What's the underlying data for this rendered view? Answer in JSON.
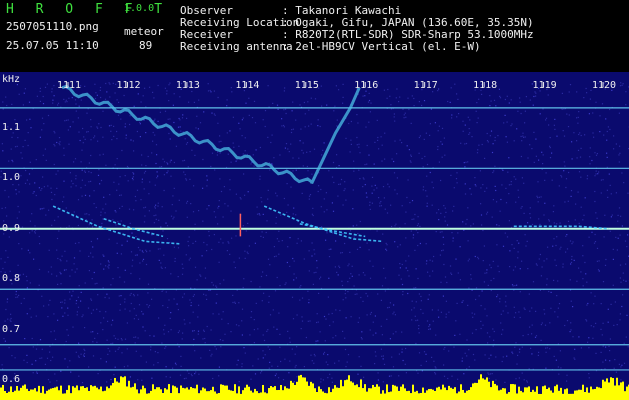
{
  "header": {
    "app_title": "H R O F F T",
    "version": "1.0.0",
    "filename": "2507051110.png",
    "kind": "meteor",
    "datetime": "25.07.05 11:10",
    "count": "89",
    "fields": [
      {
        "label": "Observer",
        "value": ": Takanori Kawachi"
      },
      {
        "label": "Receiving Location",
        "value": ": Ogaki, Gifu, JAPAN (136.60E, 35.35N)"
      },
      {
        "label": "Receiver",
        "value": ": R820T2(RTL-SDR) SDR-Sharp 53.1000MHz"
      },
      {
        "label": "Receiving antenna",
        "value": ": 2el-HB9CV Vertical (el. E-W)"
      }
    ]
  },
  "chart_data": {
    "type": "heatmap",
    "ylabel": "kHz",
    "ylim": [
      0.58,
      1.18
    ],
    "yticks": [
      "1.1",
      "1.0",
      "0.9",
      "0.8",
      "0.7",
      "0.6"
    ],
    "ytick_values": [
      1.1,
      1.0,
      0.9,
      0.8,
      0.7,
      0.6
    ],
    "xlim": [
      1110.5,
      1120.2
    ],
    "xticks": [
      "1111",
      "1112",
      "1113",
      "1114",
      "1115",
      "1116",
      "1117",
      "1118",
      "1119",
      "1120"
    ],
    "xtick_values": [
      1111,
      1112,
      1113,
      1114,
      1115,
      1116,
      1117,
      1118,
      1119,
      1120
    ],
    "carrier_lines_khz": [
      1.14,
      1.02,
      0.9,
      0.78,
      0.67,
      0.62
    ],
    "main_carrier_khz": 0.9,
    "colors": {
      "background": "#0a0a6e",
      "carrier": "#70e0ff",
      "main_carrier": "#c0ffe0",
      "echo": "#40c8ff",
      "noise": "#2a2aa0",
      "histogram": "#ffff00"
    }
  }
}
